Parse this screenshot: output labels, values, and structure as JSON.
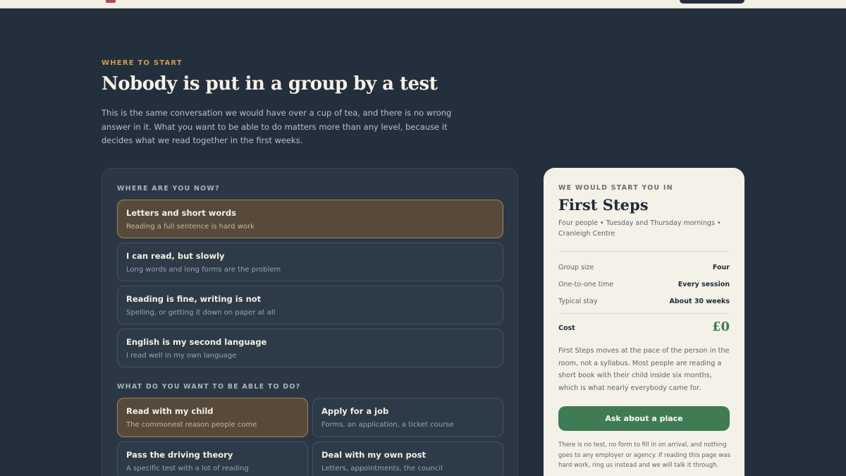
{
  "intro": {
    "eyebrow": "WHERE TO START",
    "headline": "Nobody is put in a group by a test",
    "body": "This is the same conversation we would have over a cup of tea, and there is no wrong answer in it. What you want to be able to do matters more than any level, because it decides what we read together in the first weeks."
  },
  "current_level": {
    "label": "WHERE ARE YOU NOW?",
    "options": [
      {
        "title": "Letters and short words",
        "sub": "Reading a full sentence is hard work",
        "selected": true
      },
      {
        "title": "I can read, but slowly",
        "sub": "Long words and long forms are the problem",
        "selected": false
      },
      {
        "title": "Reading is fine, writing is not",
        "sub": "Spelling, or getting it down on paper at all",
        "selected": false
      },
      {
        "title": "English is my second language",
        "sub": "I read well in my own language",
        "selected": false
      }
    ]
  },
  "goals": {
    "label": "WHAT DO YOU WANT TO BE ABLE TO DO?",
    "options": [
      {
        "title": "Read with my child",
        "sub": "The commonest reason people come",
        "selected": true
      },
      {
        "title": "Apply for a job",
        "sub": "Forms, an application, a ticket course",
        "selected": false
      },
      {
        "title": "Pass the driving theory",
        "sub": "A specific test with a lot of reading",
        "selected": false
      },
      {
        "title": "Deal with my own post",
        "sub": "Letters, appointments, the council",
        "selected": false
      }
    ]
  },
  "recommendation": {
    "eyebrow": "WE WOULD START YOU IN",
    "group_name": "First Steps",
    "meta": "Four people • Tuesday and Thursday mornings • Cranleigh Centre",
    "rows": [
      {
        "key": "Group size",
        "value": "Four"
      },
      {
        "key": "One-to-one time",
        "value": "Every session"
      },
      {
        "key": "Typical stay",
        "value": "About 30 weeks"
      }
    ],
    "cost_label": "Cost",
    "cost_value": "£0",
    "description": "First Steps moves at the pace of the person in the room, not a syllabus. Most people are reading a short book with their child inside six months, which is what nearly everybody came for.",
    "cta_label": "Ask about a place",
    "note": "There is no test, no form to fill in on arrival, and nothing goes to any employer or agency. If reading this page was hard work, ring us instead and we will talk it through."
  },
  "colors": {
    "background": "#232f3c",
    "accent_orange": "#d39a4c",
    "selected_fill": "#574a3a",
    "cta_green": "#3f7c53",
    "card_bg": "#f4f1e9"
  }
}
